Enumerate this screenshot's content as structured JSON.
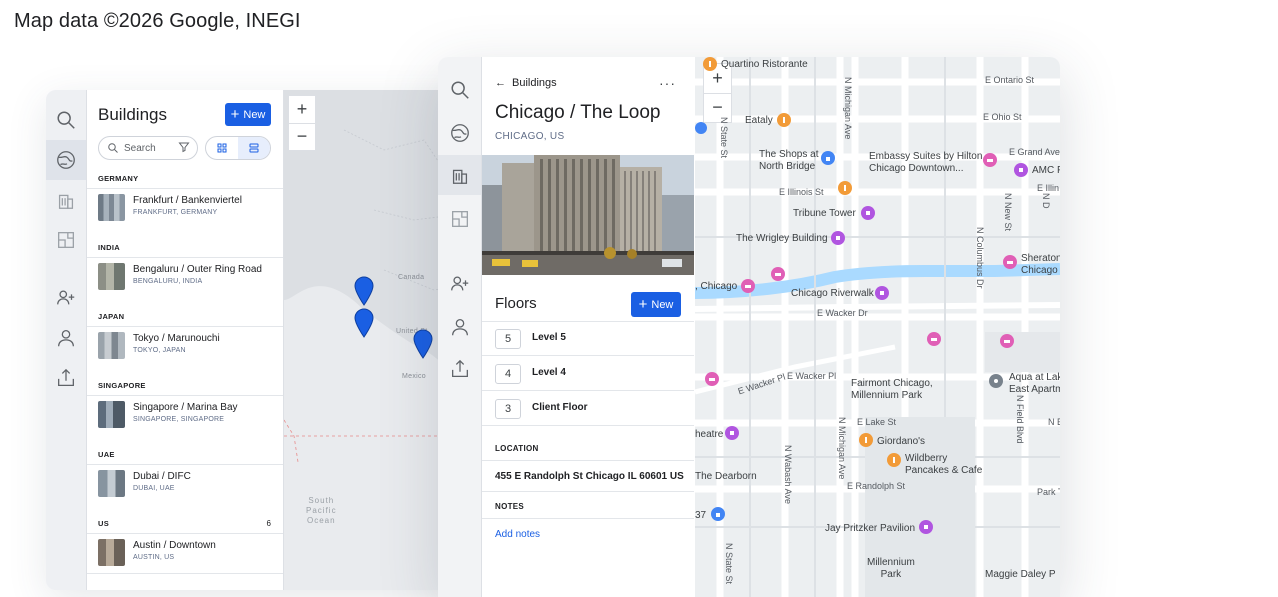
{
  "attribution": "Map data ©2026 Google, INEGI",
  "buildings_panel": {
    "title": "Buildings",
    "new_label": "New",
    "search_placeholder": "Search",
    "groups": [
      {
        "label": "GERMANY",
        "count": "",
        "items": [
          {
            "name": "Frankfurt / Bankenviertel",
            "sub": "FRANKFURT, GERMANY"
          }
        ]
      },
      {
        "label": "INDIA",
        "count": "",
        "items": [
          {
            "name": "Bengaluru / Outer Ring Road",
            "sub": "BENGALURU, INDIA"
          }
        ]
      },
      {
        "label": "JAPAN",
        "count": "",
        "items": [
          {
            "name": "Tokyo / Marunouchi",
            "sub": "TOKYO, JAPAN"
          }
        ]
      },
      {
        "label": "SINGAPORE",
        "count": "",
        "items": [
          {
            "name": "Singapore / Marina Bay",
            "sub": "SINGAPORE, SINGAPORE"
          }
        ]
      },
      {
        "label": "UAE",
        "count": "",
        "items": [
          {
            "name": "Dubai / DIFC",
            "sub": "DUBAI, UAE"
          }
        ]
      },
      {
        "label": "US",
        "count": "6",
        "items": [
          {
            "name": "Austin / Downtown",
            "sub": "AUSTIN, US"
          }
        ]
      }
    ]
  },
  "world_map": {
    "zoom_in": "+",
    "zoom_out": "−",
    "labels": {
      "canada": "Canada",
      "united_states": "United St",
      "mexico": "Mexico",
      "ocean_line1": "South",
      "ocean_line2": "Pacific",
      "ocean_line3": "Ocean"
    }
  },
  "detail_panel": {
    "back_label": "Buildings",
    "more_label": "···",
    "title": "Chicago / The Loop",
    "subtitle": "CHICAGO, US",
    "floors_title": "Floors",
    "new_label": "New",
    "floors": [
      {
        "num": "5",
        "name": "Level 5"
      },
      {
        "num": "4",
        "name": "Level 4"
      },
      {
        "num": "3",
        "name": "Client Floor"
      }
    ],
    "location_label": "LOCATION",
    "address": "455 E Randolph St Chicago IL 60601 US",
    "notes_label": "NOTES",
    "add_notes": "Add notes"
  },
  "city_map": {
    "zoom_in": "+",
    "zoom_out": "−",
    "streets": {
      "ontario": "E Ontario St",
      "ohio": "E Ohio St",
      "grand": "E Grand Ave",
      "illinois": "E Illinois St",
      "ellin": "E Illin",
      "wacker_dr": "E Wacker Dr",
      "wacker_pl": "E Wacker Pl",
      "wacker_diag": "E Wacker Pl",
      "lake": "E Lake St",
      "randolph": "E Randolph St",
      "michigan": "N Michigan Ave",
      "state": "N State St",
      "wabash": "N Wabash Ave",
      "columbus": "N Columbus Dr",
      "new_st": "N New St",
      "field": "N Field Blvd",
      "michigan2": "N Michigan Ave",
      "state2": "N State St",
      "park": "Park T",
      "ne": "N E",
      "nd": "N D"
    },
    "pois": {
      "quartino": "Quartino Ristorante",
      "eataly": "Eataly",
      "shops": "The Shops at\nNorth Bridge",
      "embassy": "Embassy Suites by Hilton\nChicago Downtown...",
      "amc": "AMC F",
      "tribune": "Tribune Tower",
      "wrigley": "The Wrigley Building",
      "sheraton": "Sheraton\nChicago",
      "chicago_left": ", Chicago",
      "riverwalk": "Chicago Riverwalk",
      "fairmont": "Fairmont Chicago,\nMillennium Park",
      "aqua": "Aqua at Lak\nEast Apartm",
      "giordano": "Giordano's",
      "wildberry": "Wildberry\nPancakes & Cafe",
      "theatre": "heatre",
      "dearborn": "The Dearborn",
      "pritzker": "Jay Pritzker Pavilion",
      "millennium": "Millennium\nPark",
      "maggie": "Maggie Daley P",
      "num37": "37"
    },
    "colors": {
      "food": "#f29b38",
      "shop": "#4285f4",
      "hotel": "#e05fb6",
      "attraction": "#b055e0",
      "water": "#aadaff"
    }
  },
  "accent_color": "#1a5fe3"
}
